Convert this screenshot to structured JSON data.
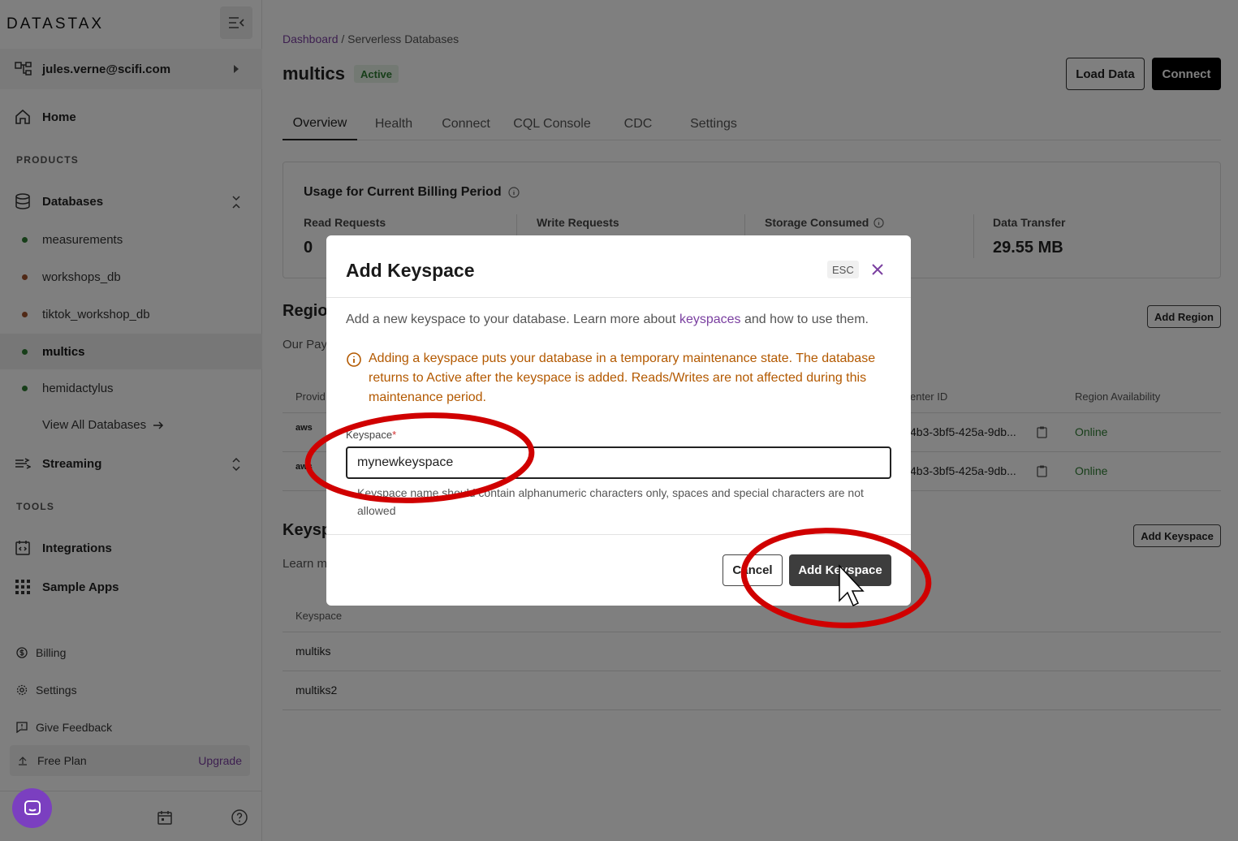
{
  "sidebar": {
    "logo": "DATASTAX",
    "account_email": "jules.verne@scifi.com",
    "home_label": "Home",
    "products_label": "PRODUCTS",
    "databases_label": "Databases",
    "databases": [
      {
        "name": "measurements",
        "status_color": "#2e7d32"
      },
      {
        "name": "workshops_db",
        "status_color": "#a0522d"
      },
      {
        "name": "tiktok_workshop_db",
        "status_color": "#a0522d"
      },
      {
        "name": "multics",
        "status_color": "#2e7d32"
      },
      {
        "name": "hemidactylus",
        "status_color": "#2e7d32"
      }
    ],
    "view_all_label": "View All Databases",
    "streaming_label": "Streaming",
    "tools_label": "TOOLS",
    "integrations_label": "Integrations",
    "sample_apps_label": "Sample Apps",
    "billing_label": "Billing",
    "settings_label": "Settings",
    "feedback_label": "Give Feedback",
    "plan_label": "Free Plan",
    "upgrade_label": "Upgrade"
  },
  "header": {
    "breadcrumb_root": "Dashboard",
    "breadcrumb_sep": " / ",
    "breadcrumb_current": "Serverless Databases",
    "db_name": "multics",
    "status": "Active",
    "load_data_label": "Load Data",
    "connect_label": "Connect"
  },
  "tabs": [
    "Overview",
    "Health",
    "Connect",
    "CQL Console",
    "CDC",
    "Settings"
  ],
  "usage": {
    "title": "Usage for Current Billing Period",
    "metrics": [
      {
        "label": "Read Requests",
        "value": "0"
      },
      {
        "label": "Write Requests",
        "value": ""
      },
      {
        "label": "Storage Consumed",
        "value": ""
      },
      {
        "label": "Data Transfer",
        "value": "29.55 MB"
      }
    ]
  },
  "regions": {
    "heading": "Region",
    "sub": "Our Pay",
    "add_label": "Add Region",
    "col_provider": "Provid",
    "col_datacenter": "enter ID",
    "col_availability": "Region Availability",
    "rows": [
      {
        "provider": "aws",
        "datacenter": "4b3-3bf5-425a-9db...",
        "availability": "Online"
      },
      {
        "provider": "aws",
        "datacenter": "4b3-3bf5-425a-9db...",
        "availability": "Online"
      }
    ]
  },
  "keyspaces": {
    "heading": "Keysp",
    "sub": "Learn m",
    "add_label": "Add Keyspace",
    "col_keyspace": "Keyspace",
    "rows": [
      "multiks",
      "multiks2"
    ]
  },
  "modal": {
    "title": "Add Keyspace",
    "esc_label": "ESC",
    "desc_before": "Add a new keyspace to your database. Learn more about ",
    "desc_link": "keyspaces",
    "desc_after": " and how to use them.",
    "warning": "Adding a keyspace puts your database in a temporary maintenance state. The database returns to Active after the keyspace is added. Reads/Writes are not affected during this maintenance period.",
    "field_label": "Keyspace",
    "field_required_mark": "*",
    "field_value": "mynewkeyspace",
    "helper": "Keyspace name should contain alphanumeric characters only, spaces and special characters are not allowed",
    "cancel_label": "Cancel",
    "submit_label": "Add Keyspace"
  },
  "colors": {
    "accent_purple": "#7a3fa0",
    "warning_orange": "#b35900",
    "online_green": "#2e7d32",
    "annotation_red": "#d00000"
  }
}
